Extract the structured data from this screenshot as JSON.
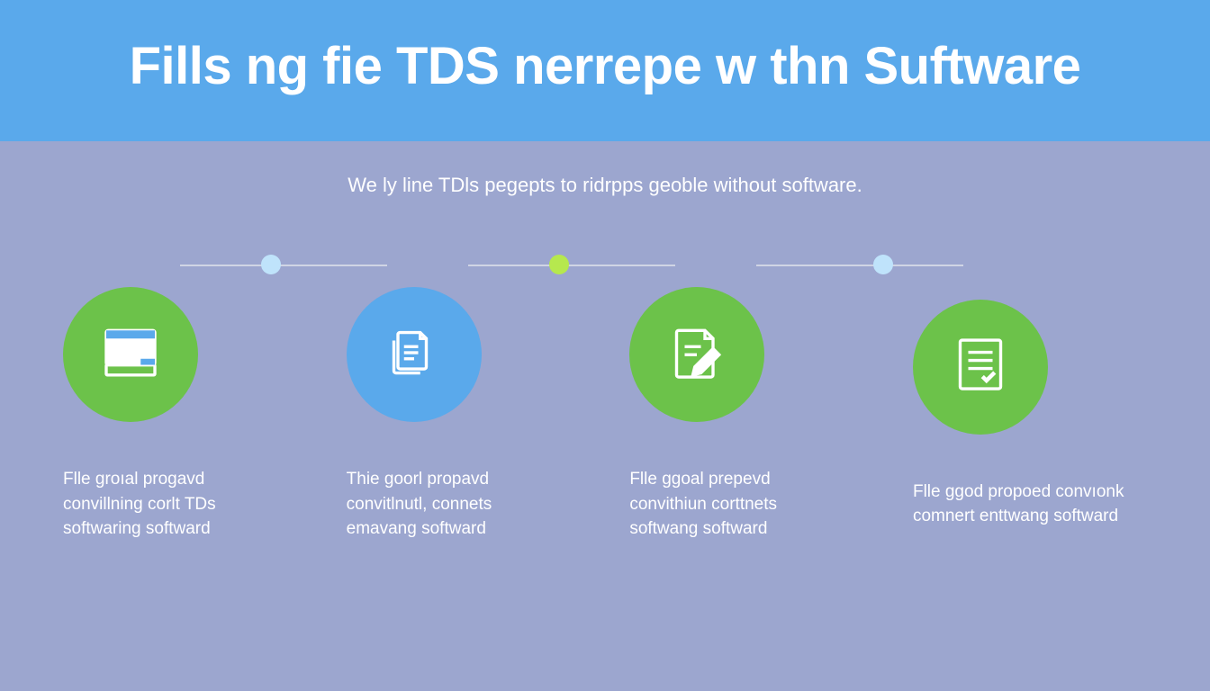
{
  "header": {
    "title": "Fills ng fie TDS nerrepe w thn Suftware"
  },
  "subtitle": "We ly line TDls pegepts to ridrpps geoble without software.",
  "steps": [
    {
      "icon": "document-box-icon",
      "color": "green",
      "caption": "Flle groıal progavd convillning corlt TDs softwaring softward"
    },
    {
      "icon": "files-stack-icon",
      "color": "blue",
      "caption": "Thie goorl propavd convitlnutl, connets emavang softward"
    },
    {
      "icon": "document-edit-icon",
      "color": "green",
      "caption": "Flle ggoal prepevd convithiun corttnets softwang softward"
    },
    {
      "icon": "document-list-icon",
      "color": "green",
      "caption": "Flle ggod propoed convıonk comnert enttwang softward"
    }
  ],
  "connectors": [
    {
      "dot_color": "lightblue"
    },
    {
      "dot_color": "lightgreen"
    },
    {
      "dot_color": "lightblue"
    }
  ],
  "colors": {
    "header_bg": "#5aa9eb",
    "body_bg": "#9ca6cf",
    "green": "#6cc24a",
    "blue": "#5aa9eb",
    "dot_lightblue": "#bfe3fb",
    "dot_lightgreen": "#b6e84e"
  }
}
